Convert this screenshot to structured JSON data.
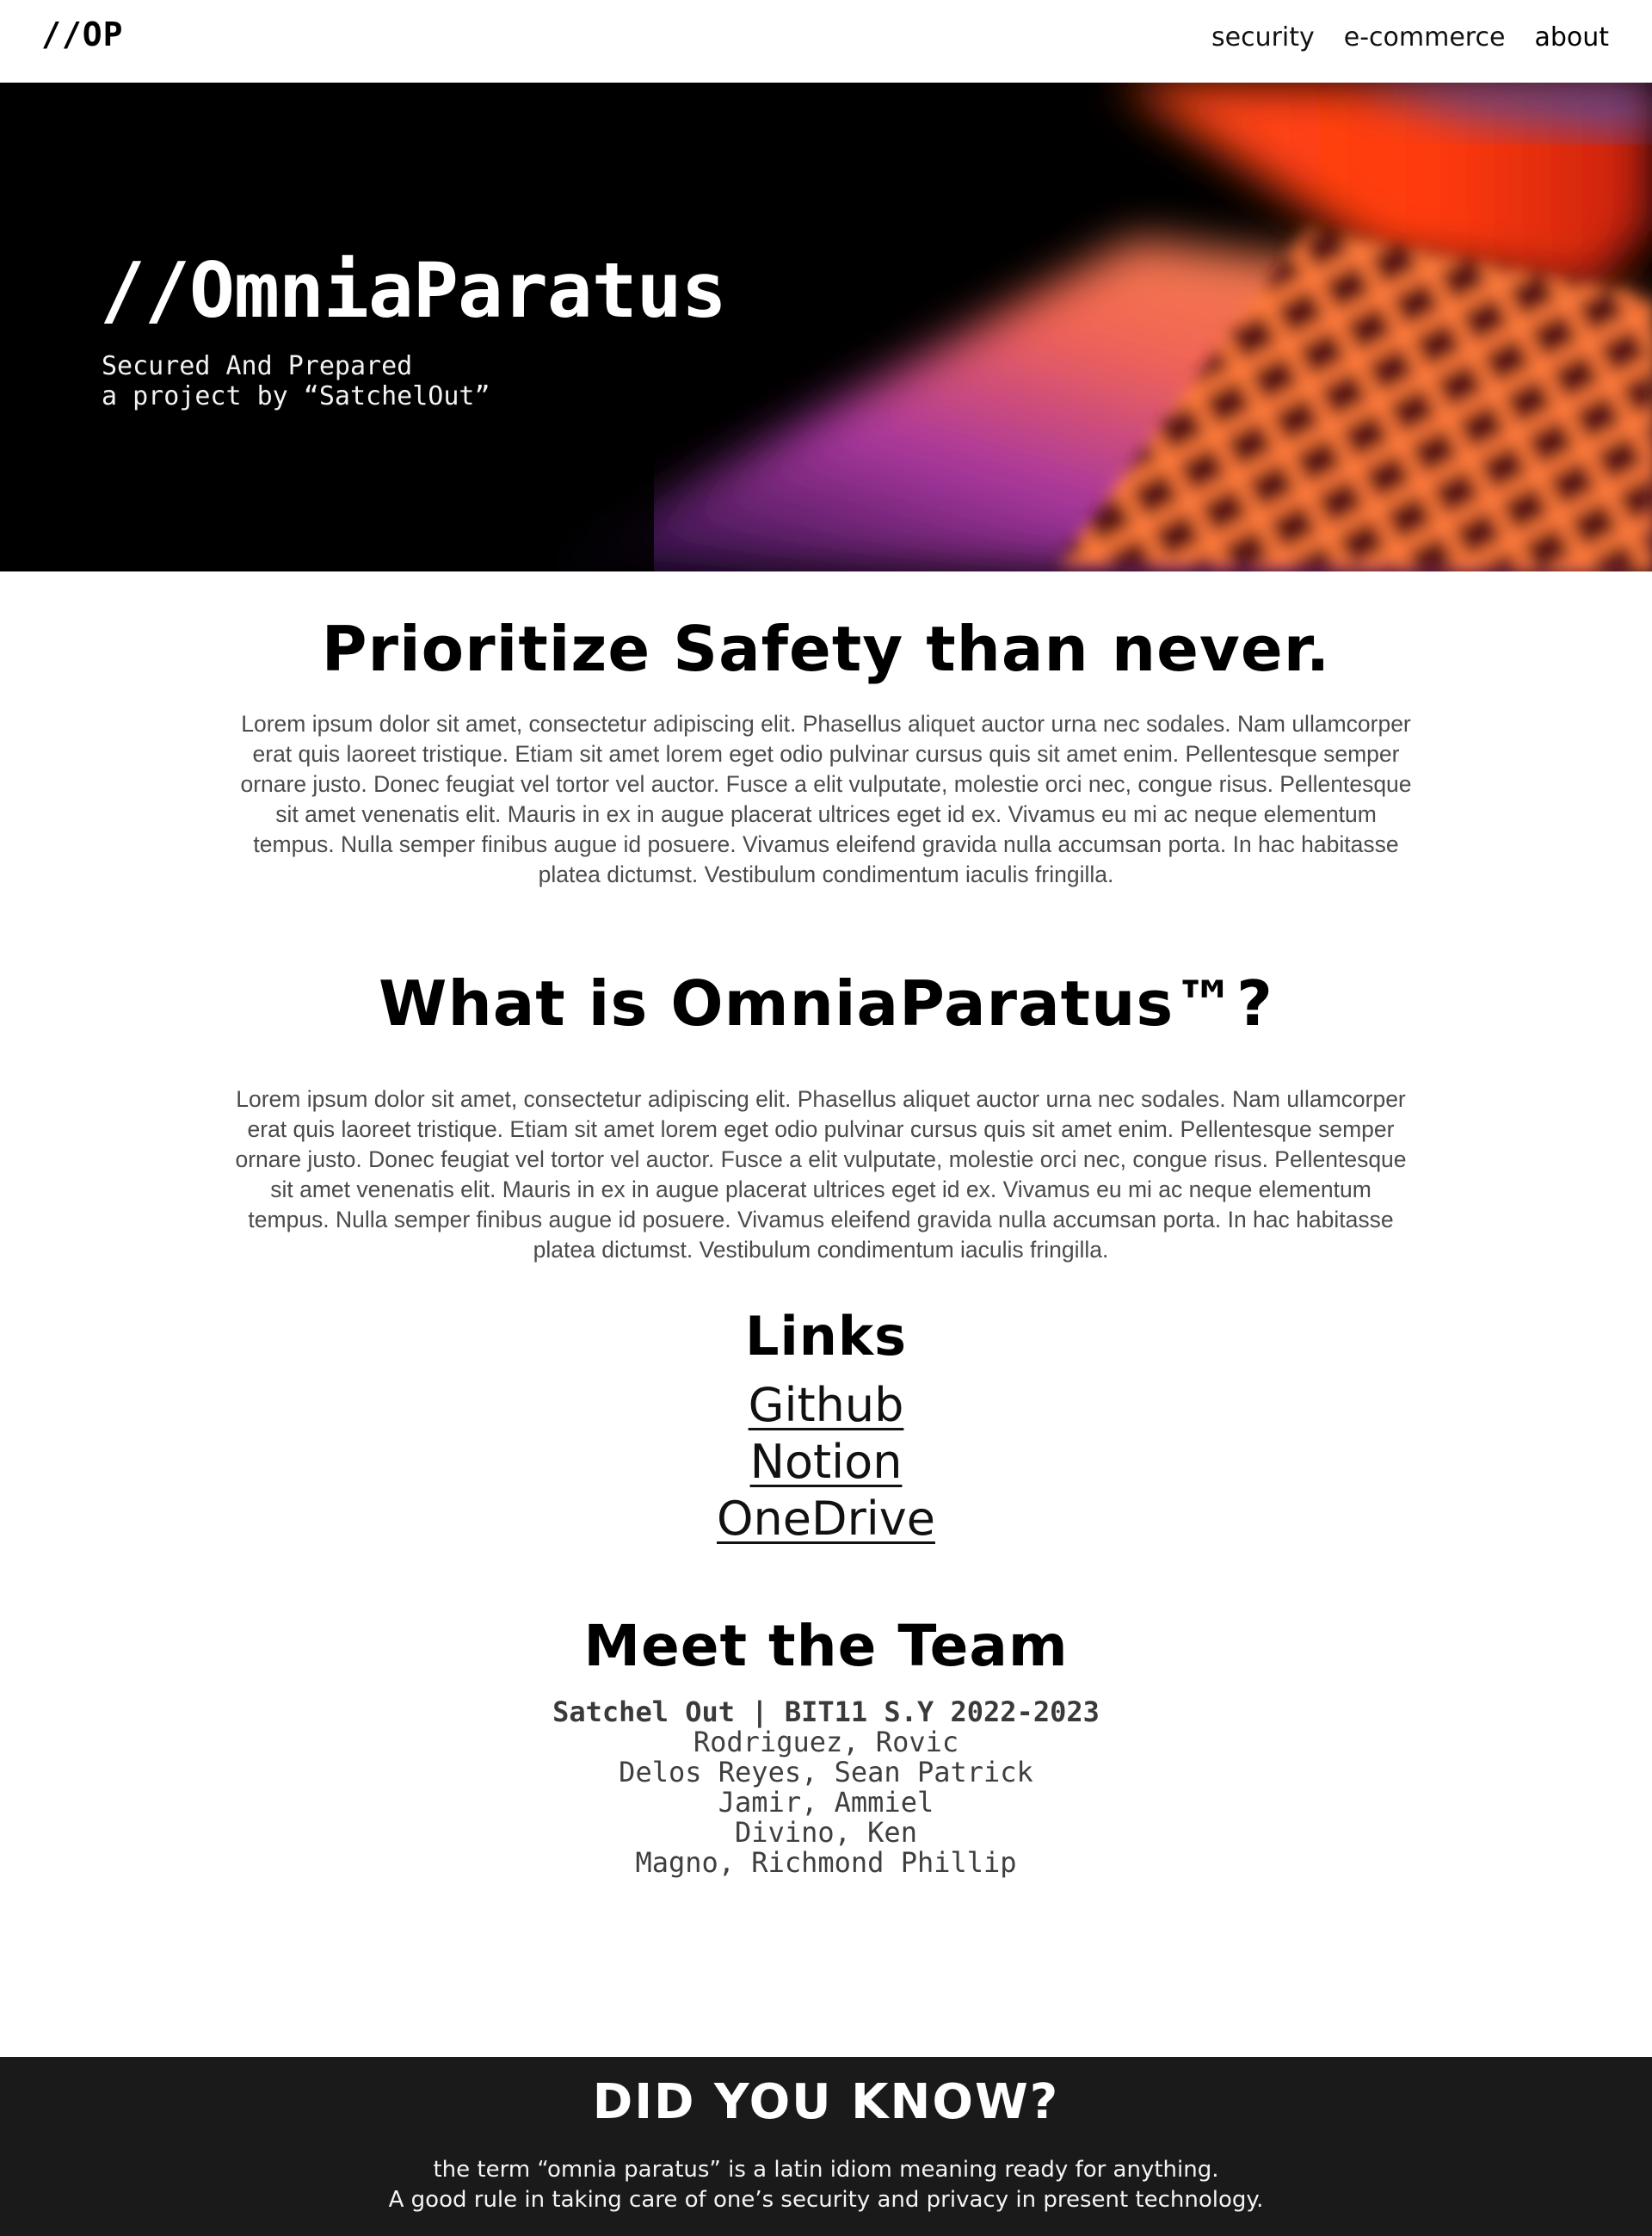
{
  "nav": {
    "logo": "//OP",
    "links": [
      "security",
      "e-commerce",
      "about"
    ],
    "active": "about"
  },
  "hero": {
    "title": "//OmniaParatus",
    "subtitle_line1": "Secured And Prepared",
    "subtitle_line2": "a project by “SatchelOut”"
  },
  "sections": [
    {
      "title": "Prioritize Safety than never.",
      "lines": [
        "Lorem ipsum dolor sit amet, consectetur adipiscing elit. Phasellus aliquet auctor urna nec sodales. Nam ullamcorper",
        "erat quis laoreet tristique. Etiam sit amet lorem eget odio pulvinar cursus quis sit amet enim. Pellentesque semper",
        "ornare justo. Donec feugiat vel tortor vel auctor. Fusce a elit vulputate, molestie orci nec, congue risus. Pellentesque",
        "sit amet venenatis elit. Mauris in ex in augue placerat ultrices eget id ex. Vivamus eu mi ac neque elementum",
        "tempus. Nulla semper finibus augue id posuere. Vivamus eleifend gravida nulla accumsan porta. In hac habitasse",
        "platea dictumst. Vestibulum condimentum iaculis fringilla."
      ]
    },
    {
      "title": "What is OmniaParatus™?",
      "lines": [
        "Lorem ipsum dolor sit amet, consectetur adipiscing elit. Phasellus aliquet auctor urna nec sodales. Nam ullamcorper",
        "erat quis laoreet tristique. Etiam sit amet lorem eget odio pulvinar cursus quis sit amet enim. Pellentesque semper",
        "ornare justo. Donec feugiat vel tortor vel auctor. Fusce a elit vulputate, molestie orci nec, congue risus. Pellentesque",
        "sit amet venenatis elit. Mauris in ex in augue placerat ultrices eget id ex. Vivamus eu mi ac neque elementum",
        "tempus. Nulla semper finibus augue id posuere. Vivamus eleifend gravida nulla accumsan porta. In hac habitasse",
        "platea dictumst. Vestibulum condimentum iaculis fringilla."
      ]
    }
  ],
  "links": {
    "title": "Links",
    "items": [
      "Github",
      "Notion",
      "OneDrive"
    ]
  },
  "team": {
    "title": "Meet the Team",
    "heading": "Satchel Out | BIT11 S.Y 2022-2023",
    "members": [
      "Rodriguez, Rovic",
      "Delos Reyes, Sean Patrick",
      "Jamir, Ammiel",
      "Divino, Ken",
      "Magno, Richmond Phillip"
    ]
  },
  "footer": {
    "title": "DID YOU KNOW?",
    "line1": "the term “omnia paratus” is a latin idiom meaning ready for anything.",
    "line2": "A good rule in taking care of one’s security and privacy in present technology."
  }
}
